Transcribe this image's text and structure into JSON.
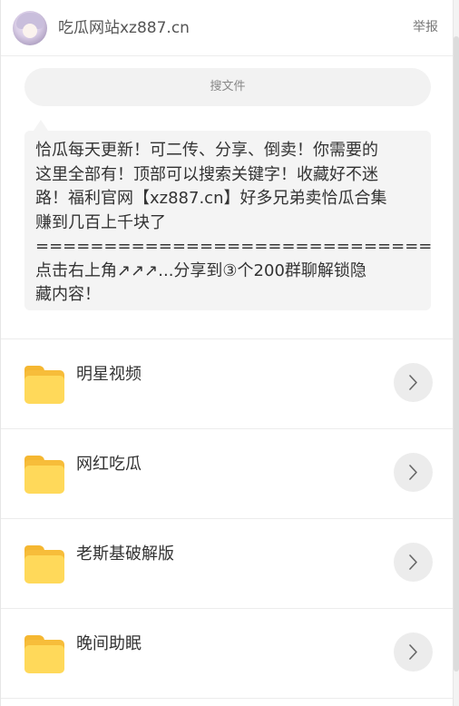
{
  "header": {
    "site_title": "吃瓜网站xz887.cn",
    "report_label": "举报",
    "avatar_icon": "anime-avatar-icon"
  },
  "search": {
    "label": "搜文件"
  },
  "notice": {
    "text": "恰瓜每天更新！可二传、分享、倒卖！你需要的\n这里全部有！顶部可以搜索关键字！收藏好不迷\n路！福利官网【xz887.cn】好多兄弟卖恰瓜合集\n赚到几百上千块了\n==========================================\n点击右上角↗↗↗...分享到③个200群聊解锁隐\n藏内容！"
  },
  "folders": [
    {
      "name": "明星视频",
      "icon": "folder-icon",
      "action_icon": "chevron-right-icon"
    },
    {
      "name": "网红吃瓜",
      "icon": "folder-icon",
      "action_icon": "chevron-right-icon"
    },
    {
      "name": "老斯基破解版",
      "icon": "folder-icon",
      "action_icon": "chevron-right-icon"
    },
    {
      "name": "晚间助眠",
      "icon": "folder-icon",
      "action_icon": "chevron-right-icon"
    }
  ],
  "colors": {
    "folder_front": "#ffd95a",
    "folder_back": "#f7bd3a",
    "button_bg": "#ececec",
    "notice_bg": "#f4f4f4"
  }
}
